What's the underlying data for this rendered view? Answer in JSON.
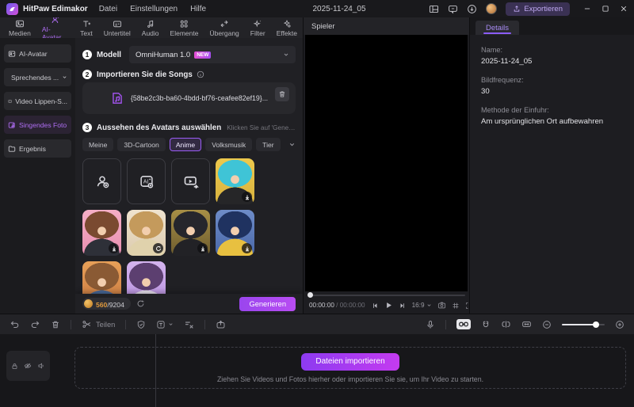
{
  "titlebar": {
    "app_name": "HitPaw Edimakor",
    "menus": [
      "Datei",
      "Einstellungen",
      "Hilfe"
    ],
    "project_title": "2025-11-24_05",
    "export_label": "Exportieren"
  },
  "ribbon": {
    "tabs": [
      "Medien",
      "AI-Avatar",
      "Text",
      "Untertitel",
      "Audio",
      "Elemente",
      "Übergang",
      "Filter",
      "Effekte"
    ],
    "active_tab": "AI-Avatar"
  },
  "sidebar": {
    "items": [
      "AI-Avatar",
      "Sprechendes ...",
      "Video Lippen-S...",
      "Singendes Foto",
      "Ergebnis"
    ],
    "active_item": "Singendes Foto"
  },
  "panel": {
    "steps": [
      {
        "num": "1",
        "label": "Modell"
      },
      {
        "num": "2",
        "label": "Importieren Sie die Songs"
      },
      {
        "num": "3",
        "label": "Aussehen des Avatars auswählen"
      }
    ],
    "model": {
      "value": "OmniHuman 1.0",
      "badge": "NEW"
    },
    "song_file": "{58be2c3b-ba60-4bdd-bf76-ceafee82ef19}...",
    "step3_hint": "Klicken Sie auf 'Generieren' für KI-...",
    "categories": [
      "Meine",
      "3D-Cartoon",
      "Anime",
      "Volksmusik",
      "Tier"
    ],
    "active_category": "Anime",
    "credits": {
      "used": "560",
      "total": "/9204"
    },
    "generate_label": "Generieren",
    "avatar_cells": [
      {
        "id": "upload-photo"
      },
      {
        "id": "ai-generate"
      },
      {
        "id": "video-template"
      },
      {
        "id": "anime-girl-cyan-hair",
        "badge": "download"
      },
      {
        "id": "anime-girl-pink-bg",
        "badge": "download"
      },
      {
        "id": "anime-girl-cream",
        "badge": "loading"
      },
      {
        "id": "anime-girl-gold-chain",
        "badge": "download"
      },
      {
        "id": "anime-girl-blue-bun",
        "badge": "download"
      },
      {
        "id": "anime-girl-sunset"
      },
      {
        "id": "anime-girl-purple-twintails"
      }
    ]
  },
  "player": {
    "title": "Spieler",
    "current_time": "00:00:00",
    "time_separator": " / ",
    "total_time": "00:00:00",
    "ratio": "16:9"
  },
  "details": {
    "tab_label": "Details",
    "fields": [
      {
        "label": "Name:",
        "value": "2025-11-24_05"
      },
      {
        "label": "Bildfrequenz:",
        "value": "30"
      },
      {
        "label": "Methode der Einfuhr:",
        "value": "Am ursprünglichen Ort aufbewahren"
      }
    ]
  },
  "timeline": {
    "split_label": "Teilen",
    "import_button": "Dateien importieren",
    "drop_hint": "Ziehen Sie Videos und Fotos hierher oder importieren Sie sie, um Ihr Video zu starten."
  },
  "colors": {
    "accent_purple": "#9b5cf6",
    "new_badge_pink": "#d94fd4",
    "credits_gold": "#e09a3e",
    "import_gradient_start": "#8d3bf0",
    "import_gradient_end": "#c43bf0"
  }
}
